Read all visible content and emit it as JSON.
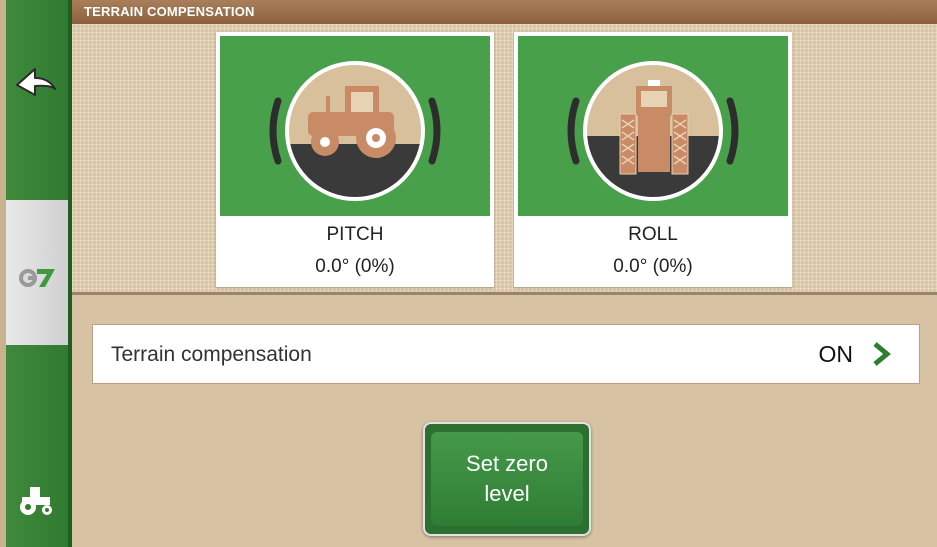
{
  "window": {
    "title": "TERRAIN COMPENSATION"
  },
  "sidebar": {
    "back_icon": "back-arrow-icon",
    "logo_icon": "g7-logo-icon",
    "tractor_icon": "tractor-icon"
  },
  "cards": [
    {
      "name": "PITCH",
      "value": "0.0° (0%)",
      "icon": "tractor-side-view-icon"
    },
    {
      "name": "ROLL",
      "value": "0.0° (0%)",
      "icon": "tractor-front-view-icon"
    }
  ],
  "setting": {
    "label": "Terrain compensation",
    "value": "ON",
    "icon": "chevron-right-icon"
  },
  "action": {
    "line1": "Set zero",
    "line2": "level"
  },
  "colors": {
    "accent_green": "#48a04b",
    "title_brown": "#8a603e",
    "background_tan": "#d7c2a4",
    "tractor_orange": "#c98a66"
  }
}
